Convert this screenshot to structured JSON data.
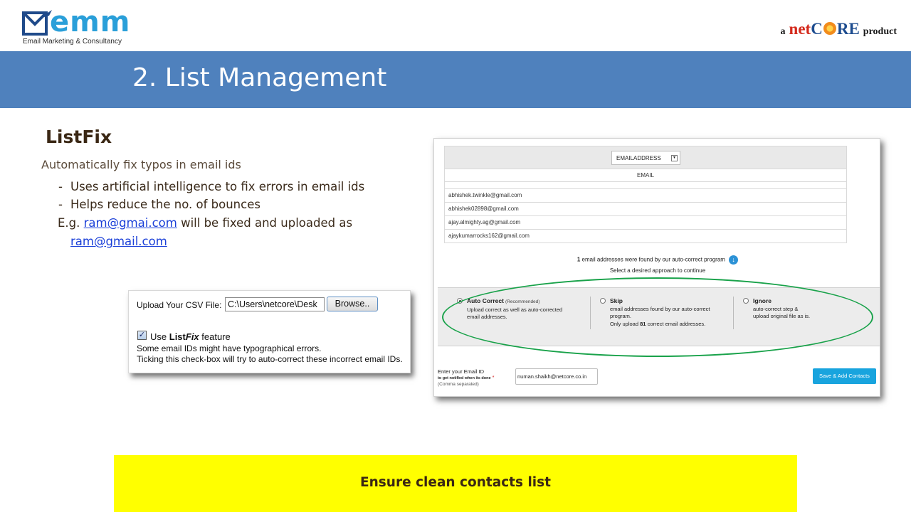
{
  "header": {
    "logo_text": "emm",
    "logo_tagline": "Email Marketing & Consultancy",
    "partner": {
      "prefix": "a",
      "net": "net",
      "c": "C",
      "re": "RE",
      "suffix": "product"
    }
  },
  "slide": {
    "title": "2. List Management",
    "section_title": "ListFix",
    "lead": "Automatically fix typos in email ids",
    "bullets": [
      "Uses artificial intelligence to fix errors in email ids",
      "Helps reduce the no. of bounces"
    ],
    "bullet_marker": "-",
    "example_prefix": "E.g.",
    "example_wrong_email": "ram@gmai.com",
    "example_middle": "will be fixed and uploaded as",
    "example_correct_email": "ram@gmail.com",
    "banner": "Ensure clean contacts list"
  },
  "upload_panel": {
    "label": "Upload Your CSV File:",
    "file_value": "C:\\Users\\netcore\\Desk",
    "browse_label": "Browse..",
    "checkbox_checked": true,
    "checkbox_mark": "✓",
    "feature_prefix": "Use",
    "feature_list": "List",
    "feature_fix": "Fix",
    "feature_suffix": "feature",
    "note_line1": "Some email IDs might have typographical errors.",
    "note_line2": "Ticking this check-box will try to auto-correct these incorrect email IDs."
  },
  "listfix_panel": {
    "column_select_value": "EMAILADDRESS",
    "select_arrow": "▾",
    "column_header": "EMAIL",
    "emails": [
      "abhishek.twinkle@gmail.com",
      "abhishek02898@gmail.com",
      "ajay.almighty.ag@gmail.com",
      "ajaykumarrocks162@gmail.com"
    ],
    "found_count": "1",
    "found_text": "email addresses were found by our auto-correct program",
    "info_icon_glyph": "↓",
    "select_note": "Select a desired approach to continue",
    "options": [
      {
        "title": "Auto Correct",
        "tag": "(Recommended)",
        "line1": "Upload correct as well as auto-corrected",
        "line2": "email addresses.",
        "line3": "",
        "selected": true
      },
      {
        "title": "Skip",
        "tag": "",
        "line1": "email addresses found by our auto-correct",
        "line2": "program.",
        "line3_prefix": "Only upload",
        "line3_count": "81",
        "line3_suffix": "correct email addresses.",
        "selected": false
      },
      {
        "title": "Ignore",
        "tag": "",
        "line1": "auto-correct step &",
        "line2": "upload original file as is.",
        "line3": "",
        "selected": false
      }
    ],
    "email_label": "Enter your Email ID",
    "email_sublabel": "to get notified when its done",
    "email_required_mark": "*",
    "email_hint": "(Comma separated)",
    "email_value": "numan.shaikh@netcore.co.in",
    "save_label": "Save & Add Contacts",
    "highlight_color": "#19a24a"
  },
  "colors": {
    "title_bar": "#4f81bd",
    "banner": "#ffff00",
    "logo": "#2a9fd9",
    "link": "#1a3fd8",
    "save_button": "#18a4de"
  }
}
